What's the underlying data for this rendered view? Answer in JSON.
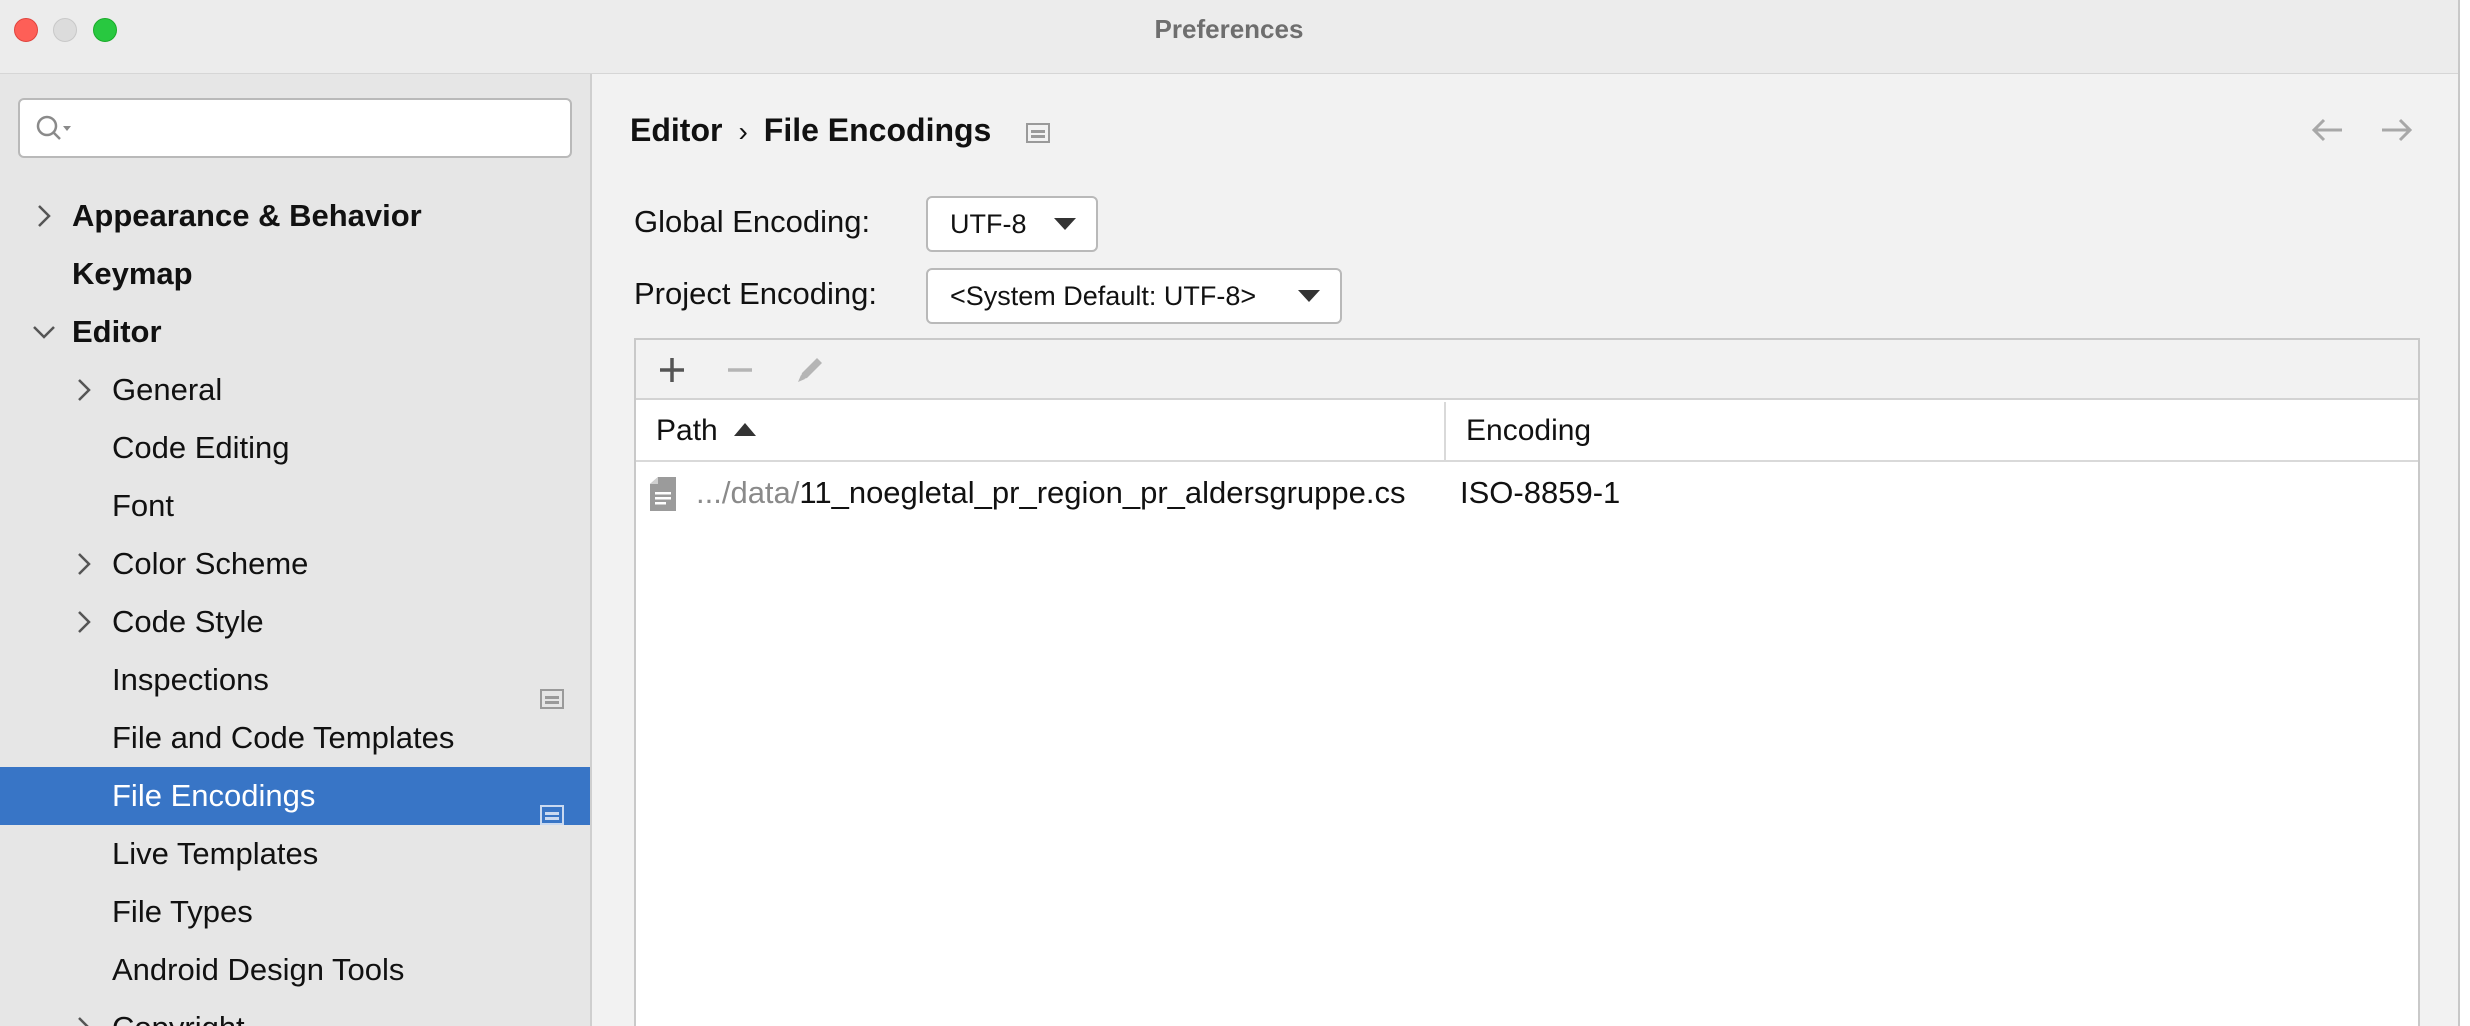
{
  "window": {
    "title": "Preferences"
  },
  "search": {
    "placeholder": "",
    "value": ""
  },
  "sidebar": {
    "items": [
      {
        "label": "Appearance & Behavior",
        "level": 0,
        "bold": true,
        "chevron": "right"
      },
      {
        "label": "Keymap",
        "level": 0,
        "bold": true,
        "chevron": "none"
      },
      {
        "label": "Editor",
        "level": 0,
        "bold": true,
        "chevron": "down"
      },
      {
        "label": "General",
        "level": 1,
        "chevron": "right"
      },
      {
        "label": "Code Editing",
        "level": 1,
        "chevron": "none"
      },
      {
        "label": "Font",
        "level": 1,
        "chevron": "none"
      },
      {
        "label": "Color Scheme",
        "level": 1,
        "chevron": "right"
      },
      {
        "label": "Code Style",
        "level": 1,
        "chevron": "right"
      },
      {
        "label": "Inspections",
        "level": 1,
        "chevron": "none",
        "project_icon": true
      },
      {
        "label": "File and Code Templates",
        "level": 1,
        "chevron": "none"
      },
      {
        "label": "File Encodings",
        "level": 1,
        "chevron": "none",
        "project_icon": true,
        "selected": true
      },
      {
        "label": "Live Templates",
        "level": 1,
        "chevron": "none"
      },
      {
        "label": "File Types",
        "level": 1,
        "chevron": "none"
      },
      {
        "label": "Android Design Tools",
        "level": 1,
        "chevron": "none"
      },
      {
        "label": "Copyright",
        "level": 1,
        "chevron": "right",
        "project_icon": true
      }
    ]
  },
  "breadcrumb": {
    "parent": "Editor",
    "separator": "›",
    "current": "File Encodings"
  },
  "settings": {
    "global_encoding_label": "Global Encoding:",
    "global_encoding_value": "UTF-8",
    "project_encoding_label": "Project Encoding:",
    "project_encoding_value": "<System Default: UTF-8>"
  },
  "table": {
    "columns": {
      "path": "Path",
      "encoding": "Encoding"
    },
    "rows": [
      {
        "path_prefix": ".../data/",
        "path_name": "11_noegletal_pr_region_pr_aldersgruppe.cs",
        "encoding": "ISO-8859-1"
      }
    ]
  },
  "colors": {
    "selection": "#3875c6",
    "sidebar_bg": "#e6e6e6",
    "window_bg": "#f2f2f2"
  }
}
